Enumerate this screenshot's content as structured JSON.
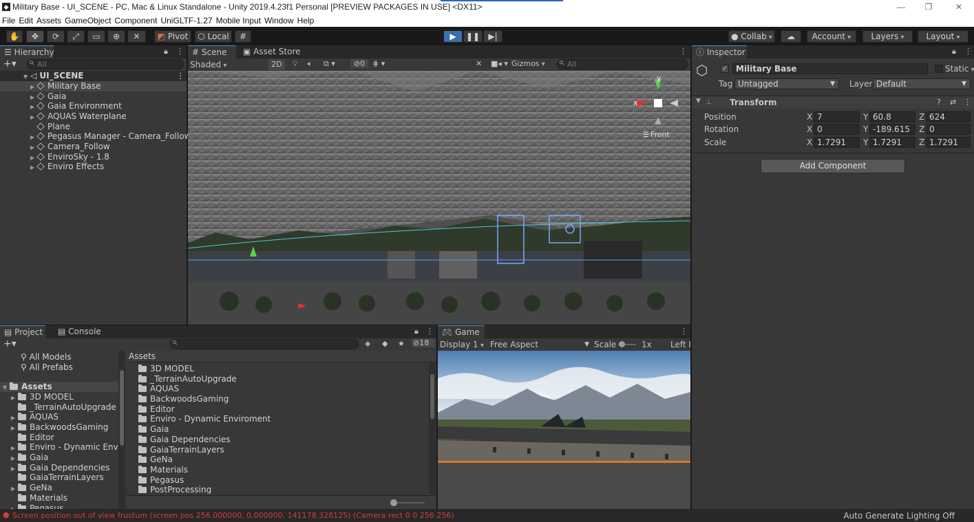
{
  "window": {
    "title": "Military Base - UI_SCENE - PC, Mac & Linux Standalone - Unity 2019.4.23f1 Personal [PREVIEW PACKAGES IN USE] <DX11>",
    "minimize": "—",
    "maximize": "❐",
    "close": "✕"
  },
  "menu": [
    "File",
    "Edit",
    "Assets",
    "GameObject",
    "Component",
    "UniGLTF-1.27",
    "Mobile Input",
    "Window",
    "Help"
  ],
  "toolbar": {
    "pivot": "Pivot",
    "local": "Local",
    "collab": "Collab",
    "account": "Account",
    "layers": "Layers",
    "layout": "Layout"
  },
  "hierarchy": {
    "tab": "Hierarchy",
    "search_placeholder": "All",
    "scene": "UI_SCENE",
    "items": [
      "Military Base",
      "Gaia",
      "Gaia Environment",
      "AQUAS Waterplane",
      "Plane",
      "Pegasus Manager - Camera_Follow",
      "Camera_Follow",
      "EnviroSky - 1.8",
      "Enviro Effects"
    ]
  },
  "scene": {
    "tab_scene": "Scene",
    "tab_store": "Asset Store",
    "shading": "Shaded",
    "mode2d": "2D",
    "hidden_count": "0",
    "gizmos": "Gizmos",
    "search_placeholder": "All",
    "axis_y": "y",
    "axis_x": "x",
    "view_label": "Front"
  },
  "inspector": {
    "tab": "Inspector",
    "object_name": "Military Base",
    "static_label": "Static",
    "tag_label": "Tag",
    "tag_value": "Untagged",
    "layer_label": "Layer",
    "layer_value": "Default",
    "component": "Transform",
    "position_label": "Position",
    "rotation_label": "Rotation",
    "scale_label": "Scale",
    "position": {
      "x": "7",
      "y": "60.8",
      "z": "624"
    },
    "rotation": {
      "x": "0",
      "y": "-189.615",
      "z": "0"
    },
    "scale": {
      "x": "1.7291",
      "y": "1.7291",
      "z": "1.7291"
    },
    "add_component": "Add Component"
  },
  "project": {
    "tab_project": "Project",
    "tab_console": "Console",
    "hidden_count": "18",
    "favorites": [
      "All Models",
      "All Prefabs"
    ],
    "root": "Assets",
    "tree": [
      "3D MODEL",
      "_TerrainAutoUpgrade",
      "AQUAS",
      "BackwoodsGaming",
      "Editor",
      "Enviro - Dynamic Enviro",
      "Gaia",
      "Gaia Dependencies",
      "GaiaTerrainLayers",
      "GeNa",
      "Materials",
      "Pegasus"
    ],
    "breadcrumb": "Assets",
    "folders": [
      "3D MODEL",
      "_TerrainAutoUpgrade",
      "AQUAS",
      "BackwoodsGaming",
      "Editor",
      "Enviro - Dynamic Enviroment",
      "Gaia",
      "Gaia Dependencies",
      "GaiaTerrainLayers",
      "GeNa",
      "Materials",
      "Pegasus",
      "PostProcessing"
    ]
  },
  "game": {
    "tab": "Game",
    "display": "Display 1",
    "aspect": "Free Aspect",
    "scale_label": "Scale",
    "scale_value": "1x",
    "left_label": "Left E"
  },
  "status": {
    "error": "Screen position out of view frustum (screen pos 256.000000, 0.000000, 141178.328125) (Camera rect 0 0 256 256)",
    "right": "Auto Generate Lighting Off",
    "error_color": "#d23c3c"
  }
}
